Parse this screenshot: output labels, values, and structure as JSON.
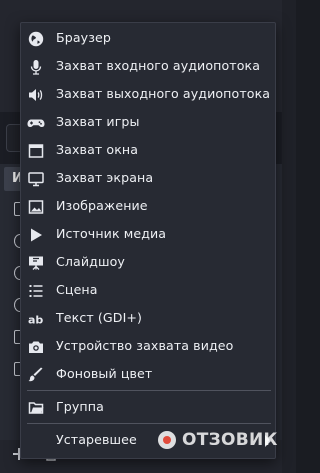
{
  "background": {
    "panel_header_text": "И"
  },
  "menu": {
    "items": [
      {
        "label": "Браузер",
        "icon": "globe-icon"
      },
      {
        "label": "Захват входного аудиопотока",
        "icon": "microphone-icon"
      },
      {
        "label": "Захват выходного аудиопотока",
        "icon": "speaker-icon"
      },
      {
        "label": "Захват игры",
        "icon": "gamepad-icon"
      },
      {
        "label": "Захват окна",
        "icon": "window-icon"
      },
      {
        "label": "Захват экрана",
        "icon": "monitor-icon"
      },
      {
        "label": "Изображение",
        "icon": "image-icon"
      },
      {
        "label": "Источник медиа",
        "icon": "play-icon"
      },
      {
        "label": "Слайдшоу",
        "icon": "slideshow-icon"
      },
      {
        "label": "Сцена",
        "icon": "list-icon"
      },
      {
        "label": "Текст (GDI+)",
        "icon": "text-icon"
      },
      {
        "label": "Устройство захвата видео",
        "icon": "camera-icon"
      },
      {
        "label": "Фоновый цвет",
        "icon": "brush-icon"
      }
    ],
    "group_item": {
      "label": "Группа",
      "icon": "folder-icon"
    },
    "deprecated_item": {
      "label": "Устаревшее",
      "icon": "submenu-arrow-icon"
    }
  },
  "watermark": {
    "text": "ОТЗОВИК"
  },
  "colors": {
    "menu_bg": "#272a33",
    "menu_text": "#eef0f4",
    "separator": "#50535e"
  }
}
